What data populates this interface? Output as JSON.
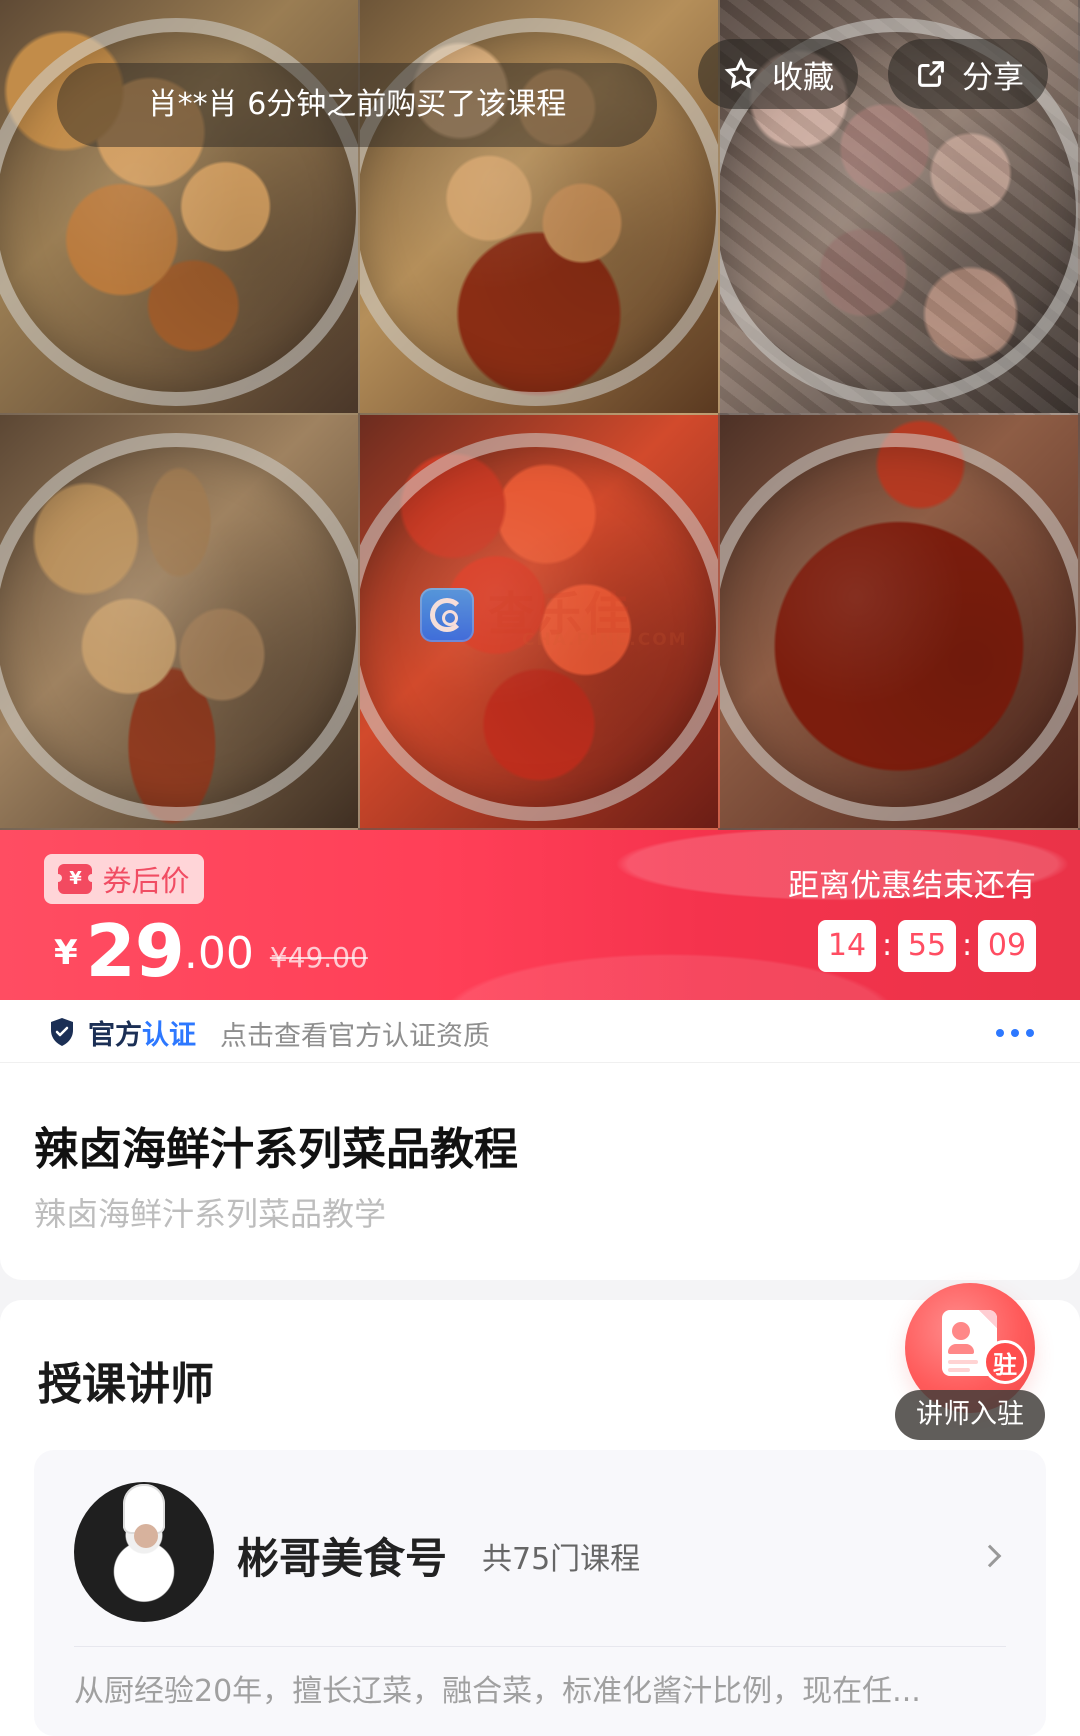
{
  "hero": {
    "purchase_notice": "肖**肖 6分钟之前购买了该课程",
    "favorite_label": "收藏",
    "share_label": "分享",
    "watermark_text": "查乐佳",
    "watermark_subtext": "CHA.PINE.COM"
  },
  "pricing": {
    "coupon_label": "券后价",
    "currency_symbol": "¥",
    "price_integer": "29",
    "price_decimal": ".00",
    "original_price": "¥49.00",
    "countdown_label": "距离优惠结束还有",
    "countdown": [
      "14",
      "55",
      "09"
    ]
  },
  "certification": {
    "title_prefix": "官方",
    "title_accent": "认证",
    "description": "点击查看官方认证资质"
  },
  "course": {
    "title": "辣卤海鲜汁系列菜品教程",
    "subtitle": "辣卤海鲜汁系列菜品教学"
  },
  "teacher_section": {
    "title": "授课讲师",
    "join_badge": "驻",
    "join_label": "讲师入驻",
    "teacher": {
      "name": "彬哥美食号",
      "course_count": "共75门课程",
      "description": "从厨经验20年，擅长辽菜，融合菜，标准化酱汁比例，现在任..."
    }
  },
  "colors": {
    "brand_red": "#ff4d62",
    "cert_blue": "#2d78ff",
    "join_red": "#ff5b5b"
  },
  "icons": {
    "favorite": "star-icon",
    "share": "share-icon",
    "certification": "shield-icon",
    "more": "more-dots-icon",
    "join": "document-user-icon",
    "chevron": "chevron-right-icon"
  }
}
